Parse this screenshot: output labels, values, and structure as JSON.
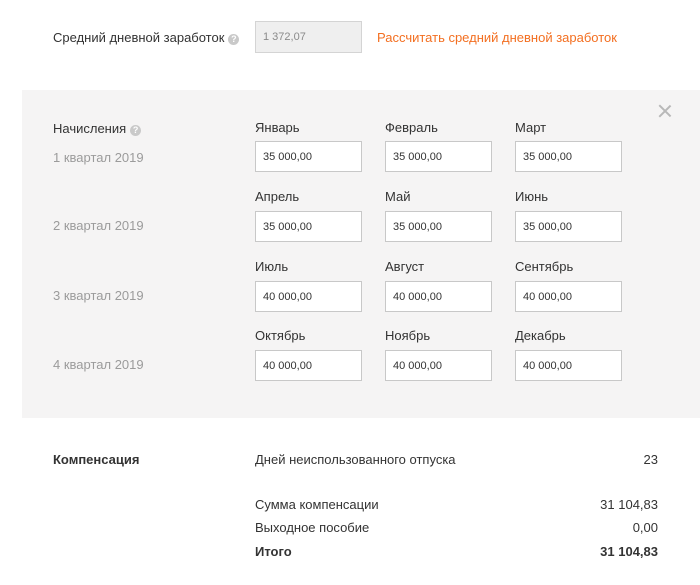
{
  "average": {
    "label": "Средний дневной заработок",
    "help_icon": "question-icon",
    "value": "1 372,07",
    "calc_link": "Рассчитать средний дневной заработок"
  },
  "accruals": {
    "title": "Начисления",
    "help_icon": "question-icon",
    "close_icon": "close-icon",
    "quarters": [
      {
        "label": "1 квартал 2019",
        "months": [
          {
            "label": "Январь",
            "value": "35 000,00"
          },
          {
            "label": "Февраль",
            "value": "35 000,00"
          },
          {
            "label": "Март",
            "value": "35 000,00"
          }
        ]
      },
      {
        "label": "2 квартал 2019",
        "months": [
          {
            "label": "Апрель",
            "value": "35 000,00"
          },
          {
            "label": "Май",
            "value": "35 000,00"
          },
          {
            "label": "Июнь",
            "value": "35 000,00"
          }
        ]
      },
      {
        "label": "3 квартал 2019",
        "months": [
          {
            "label": "Июль",
            "value": "40 000,00"
          },
          {
            "label": "Август",
            "value": "40 000,00"
          },
          {
            "label": "Сентябрь",
            "value": "40 000,00"
          }
        ]
      },
      {
        "label": "4 квартал 2019",
        "months": [
          {
            "label": "Октябрь",
            "value": "40 000,00"
          },
          {
            "label": "Ноябрь",
            "value": "40 000,00"
          },
          {
            "label": "Декабрь",
            "value": "40 000,00"
          }
        ]
      }
    ]
  },
  "compensation": {
    "title": "Компенсация",
    "rows": [
      {
        "label": "Дней неиспользованного отпуска",
        "value": "23"
      },
      {
        "label": "Сумма компенсации",
        "value": "31 104,83"
      },
      {
        "label": "Выходное пособие",
        "value": "0,00"
      },
      {
        "label": "Итого",
        "value": "31 104,83"
      }
    ]
  },
  "colors": {
    "accent": "#f36f21",
    "panel_bg": "#f5f4f4",
    "muted_text": "#9b9b9b"
  }
}
